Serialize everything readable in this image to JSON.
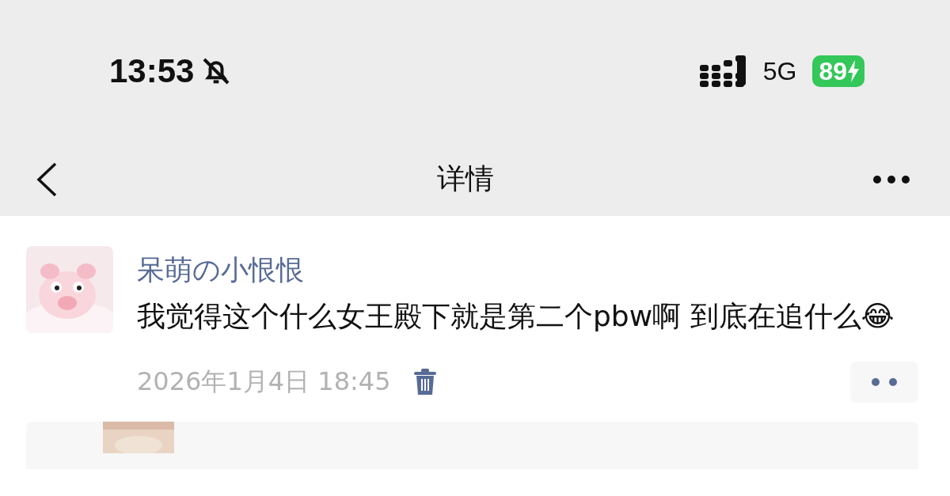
{
  "status_bar": {
    "time": "13:53",
    "network": "5G",
    "battery": "89",
    "muted": true,
    "charging": true
  },
  "nav": {
    "title": "详情"
  },
  "post": {
    "author": "呆萌の小恨恨",
    "text": "我觉得这个什么女王殿下就是第二个pbw啊 到底在追什么😂",
    "timestamp": "2026年1月4日 18:45"
  }
}
